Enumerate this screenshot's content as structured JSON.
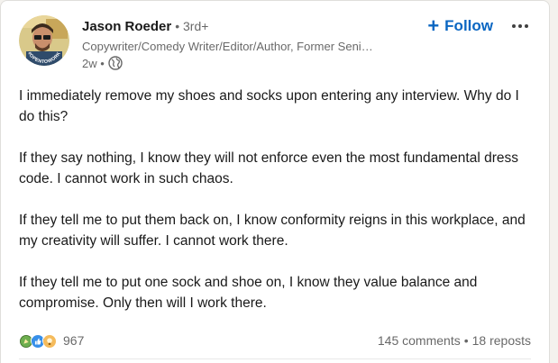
{
  "post": {
    "author": {
      "name": "Jason Roeder",
      "degree": "• 3rd+",
      "headline": "Copywriter/Comedy Writer/Editor/Author, Former Seni…",
      "time": "2w •",
      "avatar_badge": "#OPENTOWORK"
    },
    "actions": {
      "follow_label": "Follow",
      "follow_icon": "plus-icon",
      "more_icon": "more-horizontal-icon"
    },
    "paragraphs": [
      "I immediately remove my shoes and socks upon entering any interview. Why do I do this?",
      "If they say nothing, I know they will not enforce even the most fundamental dress code. I cannot work in such chaos.",
      "If they tell me to put them back on, I know conformity reigns in this workplace, and my creativity will suffer. I cannot work there.",
      "If they tell me to put one sock and shoe on, I know they value balance and compromise. Only then will I work there."
    ],
    "social": {
      "reaction_icons": [
        "celebrate-icon",
        "like-icon",
        "insightful-icon"
      ],
      "reaction_count": "967",
      "comments": "145 comments",
      "separator": "•",
      "reposts": "18 reposts"
    }
  },
  "colors": {
    "accent": "#0a66c2",
    "open_to_work": "#57a13e"
  }
}
